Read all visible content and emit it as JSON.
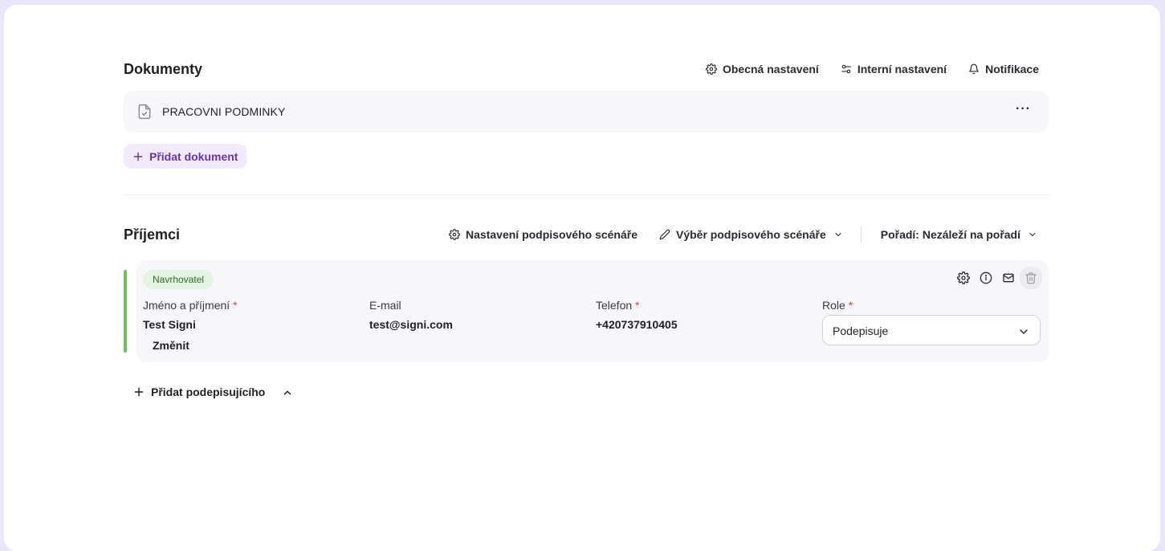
{
  "documents": {
    "title": "Dokumenty",
    "toolbar": {
      "general_settings": "Obecná nastavení",
      "internal_settings": "Interní nastavení",
      "notifications": "Notifikace"
    },
    "items": [
      {
        "name": "PRACOVNI PODMINKY"
      }
    ],
    "add_label": "Přidat dokument"
  },
  "recipients": {
    "title": "Příjemci",
    "toolbar": {
      "scenario_settings": "Nastavení podpisového scénáře",
      "scenario_select": "Výběr podpisového scénáře",
      "order": "Pořadí: Nezáleží na pořadí"
    },
    "items": [
      {
        "badge": "Navrhovatel",
        "name_label": "Jméno a příjmení",
        "email_label": "E-mail",
        "phone_label": "Telefon",
        "role_label": "Role",
        "required_mark": "*",
        "name": "Test Signi",
        "email": "test@signi.com",
        "phone": "+420737910405",
        "role": "Podepisuje",
        "change_label": "Změnit"
      }
    ],
    "add_signer_label": "Přidat podepisujícího"
  },
  "colors": {
    "accent_purple": "#6a34a8",
    "badge_green": "#e3f5e2",
    "accent_green": "#6cc25a",
    "required_red": "#d64545"
  }
}
